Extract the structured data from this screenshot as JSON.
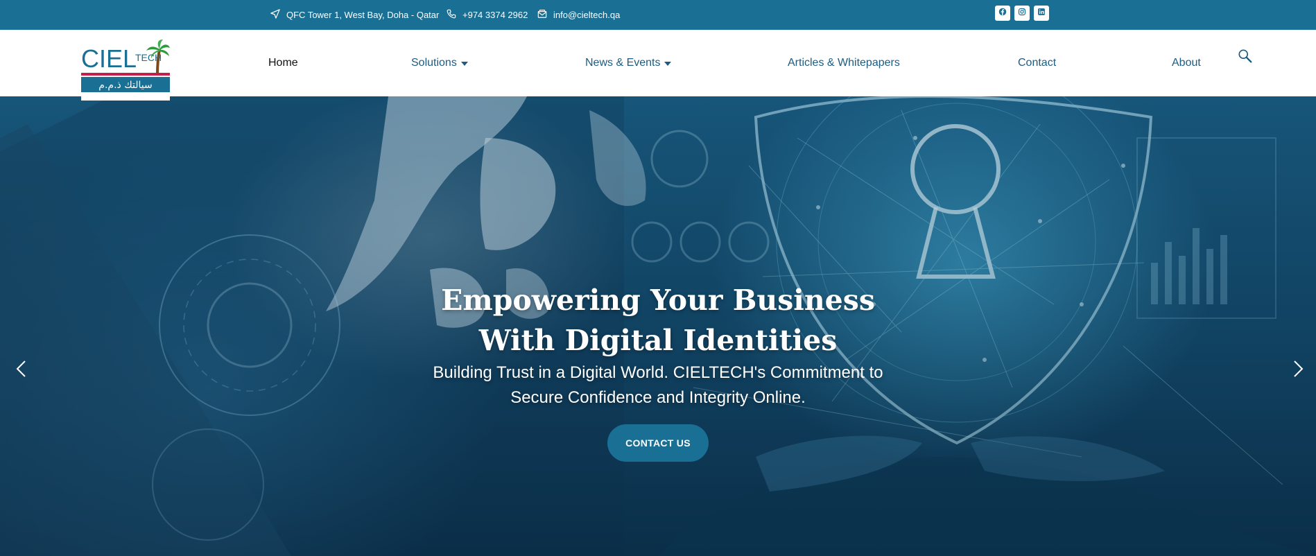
{
  "topbar": {
    "address": "QFC Tower 1, West Bay, Doha - Qatar",
    "phone": "+974 3374 2962",
    "email": "info@cieltech.qa",
    "address_icon": "location-arrow-icon",
    "phone_icon": "phone-icon",
    "email_icon": "email-icon",
    "social": [
      {
        "icon": "facebook-icon"
      },
      {
        "icon": "instagram-icon"
      },
      {
        "icon": "linkedin-icon"
      }
    ],
    "background": "#1a6f95"
  },
  "logo": {
    "text_main": "CIEL",
    "text_small": "TECH",
    "arabic": "سيالتك ذ.م.م"
  },
  "nav": {
    "home": "Home",
    "solutions": "Solutions",
    "news": "News & Events",
    "articles": "Articles & Whitepapers",
    "contact": "Contact",
    "about": "About",
    "search_icon": "search-icon"
  },
  "hero": {
    "title": "Empowering Your Business With Digital Identities",
    "subtitle": "Building Trust in a Digital World. CIELTECH's Commitment to Secure Confidence and Integrity Online.",
    "cta": "CONTACT US",
    "prev_icon": "chevron-left-icon",
    "next_icon": "chevron-right-icon"
  },
  "colors": {
    "brand": "#1a6f95",
    "nav_text": "#1d5c80",
    "logo_red": "#c2204a",
    "logo_green": "#2e9a3e"
  }
}
